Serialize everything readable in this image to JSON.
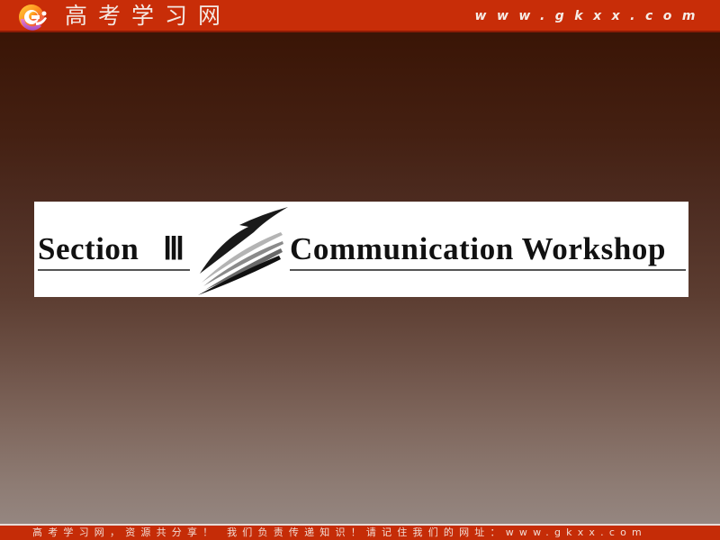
{
  "header": {
    "logo_icon": "gkxx-logo-icon",
    "site_name": "高考学习网",
    "url": "www.gkxx.com",
    "colors": {
      "bar": "#c82d08",
      "text": "#f4e8e2"
    }
  },
  "slide": {
    "section_label": "Section",
    "section_numeral": "Ⅲ",
    "divider_icon": "swoosh-icon",
    "title": "Communication Workshop",
    "colors": {
      "card": "#ffffff",
      "text": "#111111",
      "background_top": "#381304",
      "background_bottom": "#958680"
    }
  },
  "footer": {
    "text": "高考学习网，资源共分享！ 我们负责传递知识！请记住我们的网址：www.gkxx.com",
    "colors": {
      "bar": "#c52c07",
      "text": "#f2dcd4"
    }
  }
}
